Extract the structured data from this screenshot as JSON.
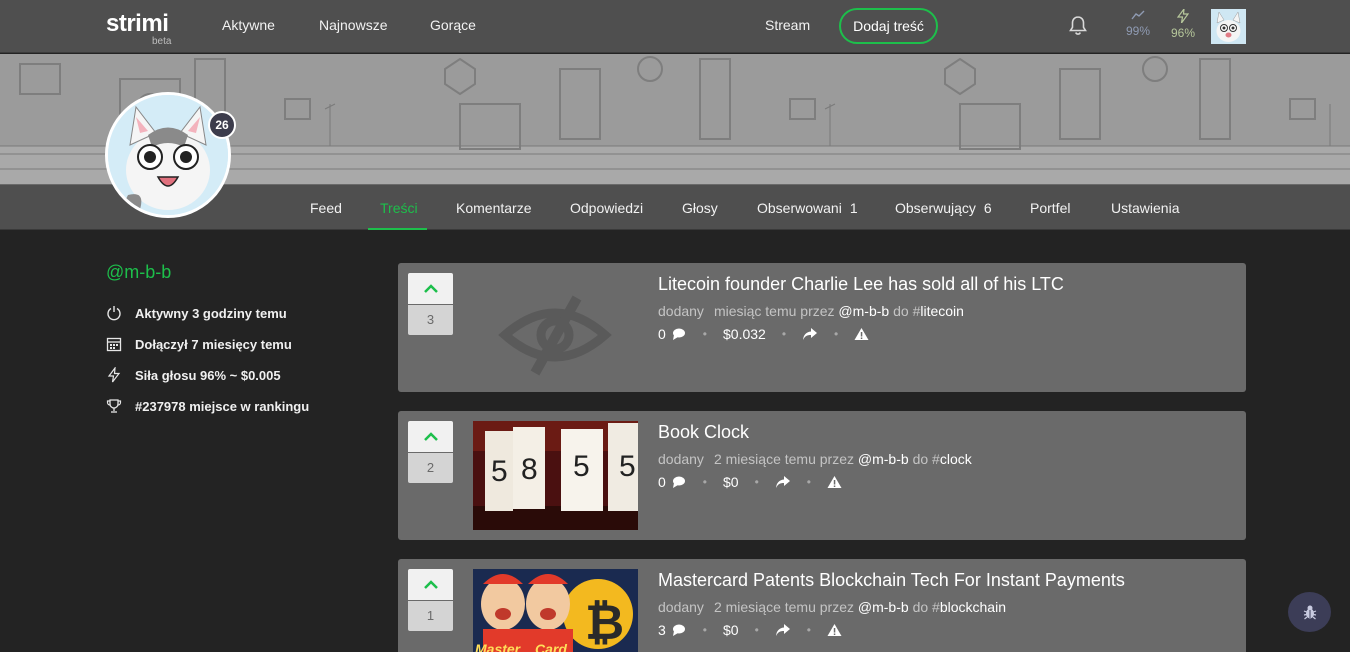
{
  "header": {
    "logo": "strimi",
    "logo_sub": "beta",
    "nav": [
      "Aktywne",
      "Najnowsze",
      "Gorące"
    ],
    "stream": "Stream",
    "add_button": "Dodaj treść",
    "stats": [
      {
        "icon": "trend-icon",
        "value": "99%"
      },
      {
        "icon": "lightning-icon",
        "value": "96%"
      }
    ],
    "colors": {
      "accent": "#1dbf4b",
      "bar": "#4f4f4f"
    }
  },
  "profile": {
    "level": "26",
    "username": "@m-b-b",
    "info": [
      {
        "icon": "power-icon",
        "text": "Aktywny 3 godziny temu"
      },
      {
        "icon": "calendar-icon",
        "text": "Dołączył 7 miesięcy temu"
      },
      {
        "icon": "lightning-icon",
        "text": "Siła głosu 96% ~ $0.005"
      },
      {
        "icon": "trophy-icon",
        "text": "#237978 miejsce w rankingu"
      }
    ]
  },
  "tabs": [
    {
      "label": "Feed"
    },
    {
      "label": "Treści",
      "active": true
    },
    {
      "label": "Komentarze"
    },
    {
      "label": "Odpowiedzi"
    },
    {
      "label": "Głosy"
    },
    {
      "label": "Obserwowani",
      "count": "1"
    },
    {
      "label": "Obserwujący",
      "count": "6"
    },
    {
      "label": "Portfel"
    },
    {
      "label": "Ustawienia"
    }
  ],
  "posts": [
    {
      "votes": "3",
      "title": "Litecoin founder Charlie Lee has sold all of his LTC",
      "added": "dodany",
      "time": "miesiąc temu",
      "by": "przez",
      "author": "@m-b-b",
      "to": "do",
      "tag_hash": "#",
      "tag": "litecoin",
      "comments": "0",
      "value": "$0.032",
      "thumb": "no-image"
    },
    {
      "votes": "2",
      "title": "Book Clock",
      "added": "dodany",
      "time": "2 miesiące temu",
      "by": "przez",
      "author": "@m-b-b",
      "to": "do",
      "tag_hash": "#",
      "tag": "clock",
      "comments": "0",
      "value": "$0",
      "thumb": "clock"
    },
    {
      "votes": "1",
      "title": "Mastercard Patents Blockchain Tech For Instant Payments",
      "added": "dodany",
      "time": "2 miesiące temu",
      "by": "przez",
      "author": "@m-b-b",
      "to": "do",
      "tag_hash": "#",
      "tag": "blockchain",
      "comments": "3",
      "value": "$0",
      "thumb": "mastercard"
    }
  ],
  "book_clock_digits": [
    "5",
    "8",
    "5",
    "5"
  ],
  "mastercard_thumb_text": [
    "Master",
    "Card"
  ]
}
